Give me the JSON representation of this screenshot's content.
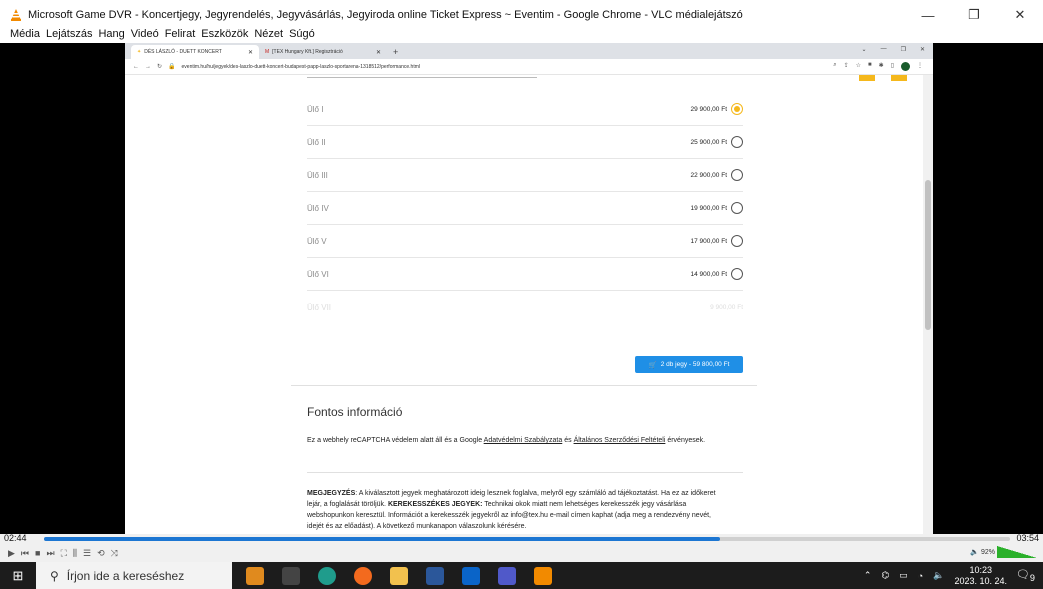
{
  "window": {
    "title": "Microsoft Game DVR - Koncertjegy, Jegyrendelés, Jegyvásárlás, Jegyiroda online Ticket Express ~ Eventim - Google Chrome - VLC médialejátszó",
    "minimize": "—",
    "maximize": "❐",
    "close": "✕"
  },
  "vlc_menu": [
    "Média",
    "Lejátszás",
    "Hang",
    "Videó",
    "Felirat",
    "Eszközök",
    "Nézet",
    "Súgó"
  ],
  "chrome": {
    "tabs": [
      {
        "label": "DÉS LÁSZLÓ - DUETT KONCERT",
        "active": true
      },
      {
        "label": "[TEX Hungary Kft.] Regisztráció",
        "active": false
      }
    ],
    "new_tab": "+",
    "url": "eventim.hu/hu/jegyek/des-laszlo-duett-koncert-budapest-papp-laszlo-sportarena-1318512/performance.html"
  },
  "seats": [
    {
      "name": "Ülő I",
      "price": "29 900,00 Ft",
      "selected": true
    },
    {
      "name": "Ülő II",
      "price": "25 900,00 Ft",
      "selected": false
    },
    {
      "name": "Ülő III",
      "price": "22 900,00 Ft",
      "selected": false
    },
    {
      "name": "Ülő IV",
      "price": "19 900,00 Ft",
      "selected": false
    },
    {
      "name": "Ülő V",
      "price": "17 900,00 Ft",
      "selected": false
    },
    {
      "name": "Ülő VI",
      "price": "14 900,00 Ft",
      "selected": false
    },
    {
      "name": "Ülő VII",
      "price": "9 900,00 Ft",
      "selected": false
    }
  ],
  "cart_button": "2 db jegy - 59 800,00 Ft",
  "info": {
    "title": "Fontos információ",
    "recaptcha_pre": "Ez a webhely reCAPTCHA védelem alatt áll és a Google ",
    "privacy_link": "Adatvédelmi Szabályzata",
    "and": " és ",
    "terms_link": "Általános Szerződési Feltételi",
    "recaptcha_post": " érvényesek.",
    "note_label": "MEGJEGYZÉS",
    "note_text1": ": A kiválasztott jegyek meghatározott ideig lesznek foglalva, melyről egy számláló ad tájékoztatást. Ha ez az időkeret lejár, a foglalását töröljük. ",
    "wheelchair_label": "KEREKESSZÉKES JEGYEK:",
    "note_text2": " Technikai okok miatt nem lehetséges kerekesszék jegy vásárlása webshopunkon keresztül. Információt a kerekesszék jegyekről az info@tex.hu e-mail címen kaphat (adja meg a rendezvény nevét, idejét és az előadást). A következő munkanapon válaszolunk kérésére."
  },
  "player": {
    "elapsed": "02:44",
    "total": "03:54",
    "progress": 0.7,
    "volume": "92%"
  },
  "taskbar": {
    "search_placeholder": "Írjon ide a kereséshez",
    "time": "10:23",
    "date": "2023. 10. 24.",
    "notifications": "9"
  }
}
